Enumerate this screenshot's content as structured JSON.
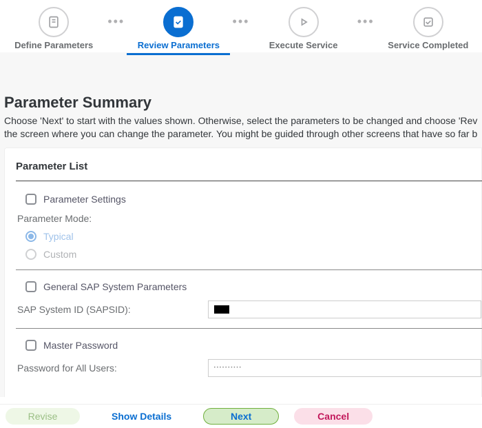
{
  "stepper": {
    "steps": [
      {
        "label": "Define Parameters"
      },
      {
        "label": "Review Parameters"
      },
      {
        "label": "Execute Service"
      },
      {
        "label": "Service Completed"
      }
    ],
    "activeIndex": 1
  },
  "summary": {
    "title": "Parameter Summary",
    "description_line1": "Choose 'Next' to start with the values shown. Otherwise, select the parameters to be changed and choose 'Rev",
    "description_line2": "the screen where you can change the parameter. You might be guided through other screens that have so far b"
  },
  "panel": {
    "title": "Parameter List",
    "sections": {
      "parameter_settings": {
        "checkbox_label": "Parameter Settings",
        "mode_label": "Parameter Mode:",
        "mode_options": [
          "Typical",
          "Custom"
        ],
        "mode_selected": "Typical"
      },
      "sap_system": {
        "checkbox_label": "General SAP System Parameters",
        "field_label": "SAP System ID (SAPSID):",
        "field_value_masked": true
      },
      "master_password": {
        "checkbox_label": "Master Password",
        "field_label": "Password for All Users:",
        "field_value_masked_dots": "••••••••••"
      }
    }
  },
  "footer": {
    "revise": "Revise",
    "show_details": "Show Details",
    "next": "Next",
    "cancel": "Cancel"
  }
}
